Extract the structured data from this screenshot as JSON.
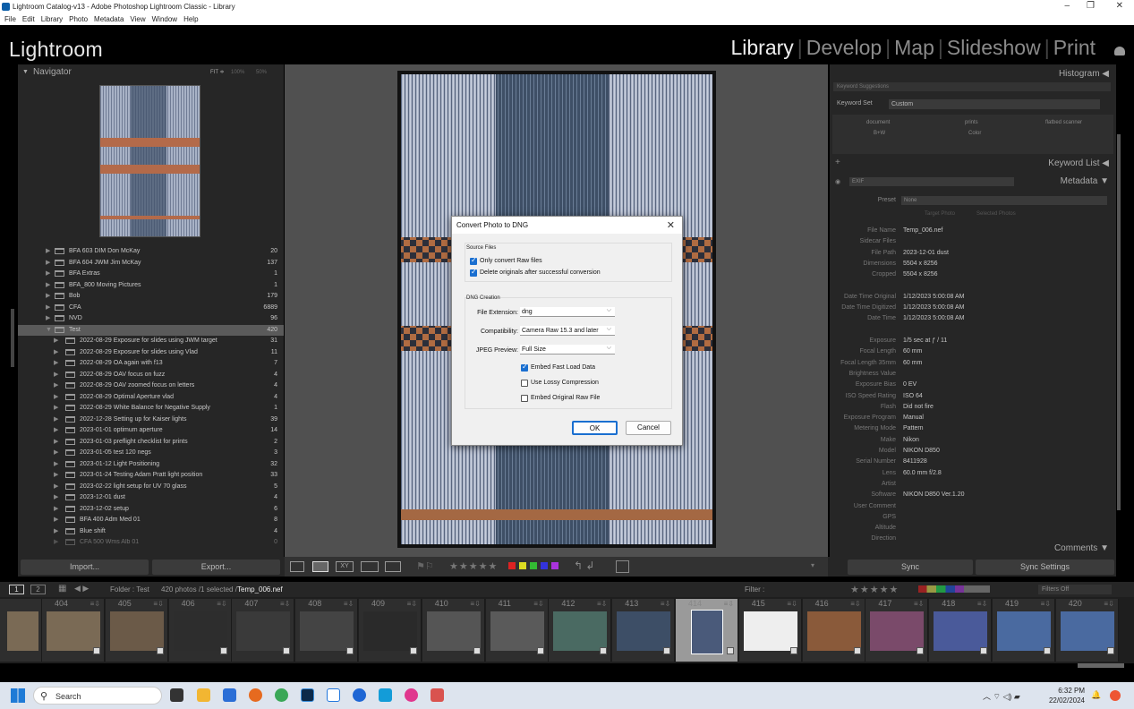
{
  "window": {
    "title": "Lightroom Catalog-v13 - Adobe Photoshop Lightroom Classic - Library"
  },
  "menu": [
    "File",
    "Edit",
    "Library",
    "Photo",
    "Metadata",
    "View",
    "Window",
    "Help"
  ],
  "identity": {
    "logo": "Lightroom"
  },
  "modules": [
    "Library",
    "Develop",
    "Map",
    "Slideshow",
    "Print"
  ],
  "navigator": {
    "title": "Navigator",
    "zoom_fit": "FIT ≑",
    "zoom_100": "100%",
    "zoom_50": "50%"
  },
  "folders": [
    {
      "name": "BFA 603 DIM Don McKay",
      "count": "20",
      "level": 0,
      "selected": false
    },
    {
      "name": "BFA 604 JWM Jim McKay",
      "count": "137",
      "level": 0,
      "selected": false
    },
    {
      "name": "BFA Extras",
      "count": "1",
      "level": 0,
      "selected": false
    },
    {
      "name": "BFA_800 Moving Pictures",
      "count": "1",
      "level": 0,
      "selected": false
    },
    {
      "name": "Bob",
      "count": "179",
      "level": 0,
      "selected": false
    },
    {
      "name": "CFA",
      "count": "6889",
      "level": 0,
      "selected": false
    },
    {
      "name": "NVD",
      "count": "96",
      "level": 0,
      "selected": false
    },
    {
      "name": "Test",
      "count": "420",
      "level": 0,
      "selected": true
    },
    {
      "name": "2022-08-29 Exposure for slides using JWM target",
      "count": "31",
      "level": 1,
      "selected": false
    },
    {
      "name": "2022-08-29 Exposure for slides using Vlad",
      "count": "11",
      "level": 1,
      "selected": false
    },
    {
      "name": "2022-08-29 OA again with f13",
      "count": "7",
      "level": 1,
      "selected": false
    },
    {
      "name": "2022-08-29 OAV focus on fuzz",
      "count": "4",
      "level": 1,
      "selected": false
    },
    {
      "name": "2022-08-29 OAV zoomed focus on letters",
      "count": "4",
      "level": 1,
      "selected": false
    },
    {
      "name": "2022-08-29 Optimal Aperture vlad",
      "count": "4",
      "level": 1,
      "selected": false
    },
    {
      "name": "2022-08-29 White Balance for Negative Supply",
      "count": "1",
      "level": 1,
      "selected": false
    },
    {
      "name": "2022-12-28 Setting up for Kaiser lights",
      "count": "39",
      "level": 1,
      "selected": false
    },
    {
      "name": "2023-01-01 optimum aperture",
      "count": "14",
      "level": 1,
      "selected": false
    },
    {
      "name": "2023-01-03 preflight checklist for prints",
      "count": "2",
      "level": 1,
      "selected": false
    },
    {
      "name": "2023-01-05 test 120 negs",
      "count": "3",
      "level": 1,
      "selected": false
    },
    {
      "name": "2023-01-12 Light Positioning",
      "count": "32",
      "level": 1,
      "selected": false
    },
    {
      "name": "2023-01-24 Testing Adam Pratt light position",
      "count": "33",
      "level": 1,
      "selected": false
    },
    {
      "name": "2023-02-22 light setup for UV 70 glass",
      "count": "5",
      "level": 1,
      "selected": false
    },
    {
      "name": "2023-12-01 dust",
      "count": "4",
      "level": 1,
      "selected": false
    },
    {
      "name": "2023-12-02 setup",
      "count": "6",
      "level": 1,
      "selected": false
    },
    {
      "name": "BFA 400 Adm Med 01",
      "count": "8",
      "level": 1,
      "selected": false
    },
    {
      "name": "Blue shift",
      "count": "4",
      "level": 1,
      "selected": false
    },
    {
      "name": "CFA 500 Wms Alb 01",
      "count": "0",
      "level": 1,
      "selected": false
    }
  ],
  "left_buttons": {
    "import": "Import...",
    "export": "Export..."
  },
  "right_panel": {
    "histogram": "Histogram",
    "keyword_suggestions": "Keyword Suggestions",
    "keyword_set_label": "Keyword Set",
    "keyword_set_value": "Custom",
    "keywords": [
      "document",
      "prints",
      "flatbed scanner",
      "B+W",
      "Color"
    ],
    "keyword_list": "Keyword List",
    "metadata": "Metadata",
    "metadata_view": "EXIF",
    "preset_label": "Preset",
    "preset_value": "None",
    "target_photo": "Target Photo",
    "selected_photos": "Selected Photos",
    "comments": "Comments",
    "sync": "Sync",
    "sync_settings": "Sync Settings"
  },
  "metadata_rows": [
    {
      "k": "File Name",
      "v": "Temp_006.nef"
    },
    {
      "k": "Sidecar Files",
      "v": ""
    },
    {
      "k": "File Path",
      "v": "2023-12-01 dust"
    },
    {
      "k": "Dimensions",
      "v": "5504 x 8256"
    },
    {
      "k": "Cropped",
      "v": "5504 x 8256"
    },
    {
      "k": "",
      "v": ""
    },
    {
      "k": "Date Time Original",
      "v": "1/12/2023 5:00:08 AM"
    },
    {
      "k": "Date Time Digitized",
      "v": "1/12/2023 5:00:08 AM"
    },
    {
      "k": "Date Time",
      "v": "1/12/2023 5:00:08 AM"
    },
    {
      "k": "",
      "v": ""
    },
    {
      "k": "Exposure",
      "v": "1/5 sec at ƒ / 11"
    },
    {
      "k": "Focal Length",
      "v": "60 mm"
    },
    {
      "k": "Focal Length 35mm",
      "v": "60 mm"
    },
    {
      "k": "Brightness Value",
      "v": ""
    },
    {
      "k": "Exposure Bias",
      "v": "0 EV"
    },
    {
      "k": "ISO Speed Rating",
      "v": "ISO 64"
    },
    {
      "k": "Flash",
      "v": "Did not fire"
    },
    {
      "k": "Exposure Program",
      "v": "Manual"
    },
    {
      "k": "Metering Mode",
      "v": "Pattern"
    },
    {
      "k": "Make",
      "v": "Nikon"
    },
    {
      "k": "Model",
      "v": "NIKON D850"
    },
    {
      "k": "Serial Number",
      "v": "8411928"
    },
    {
      "k": "Lens",
      "v": "60.0 mm f/2.8"
    },
    {
      "k": "Artist",
      "v": ""
    },
    {
      "k": "Software",
      "v": "NIKON D850 Ver.1.20"
    },
    {
      "k": "User Comment",
      "v": ""
    },
    {
      "k": "GPS",
      "v": ""
    },
    {
      "k": "Altitude",
      "v": ""
    },
    {
      "k": "Direction",
      "v": ""
    }
  ],
  "filterbar": {
    "page1": "1",
    "page2": "2",
    "folder": "Folder : Test",
    "count": "420 photos /1 selected /",
    "file": "Temp_006.nef",
    "filter": "Filter :",
    "filters_off": "Filters Off"
  },
  "filmstrip": [
    "404",
    "405",
    "406",
    "407",
    "408",
    "409",
    "410",
    "411",
    "412",
    "413",
    "414",
    "415",
    "416",
    "417",
    "418",
    "419",
    "420"
  ],
  "dialog": {
    "title": "Convert Photo to DNG",
    "source_files": "Source Files",
    "only_raw": "Only convert Raw files",
    "delete_orig": "Delete originals after successful conversion",
    "dng_creation": "DNG Creation",
    "file_ext_label": "File Extension:",
    "file_ext_value": "dng",
    "compat_label": "Compatibility:",
    "compat_value": "Camera Raw 15.3 and later",
    "jpeg_label": "JPEG Preview:",
    "jpeg_value": "Full Size",
    "embed_fast": "Embed Fast Load Data",
    "lossy": "Use Lossy Compression",
    "embed_raw": "Embed Original Raw File",
    "ok": "OK",
    "cancel": "Cancel"
  },
  "taskbar": {
    "search": "Search",
    "time": "6:32 PM",
    "date": "22/02/2024"
  }
}
